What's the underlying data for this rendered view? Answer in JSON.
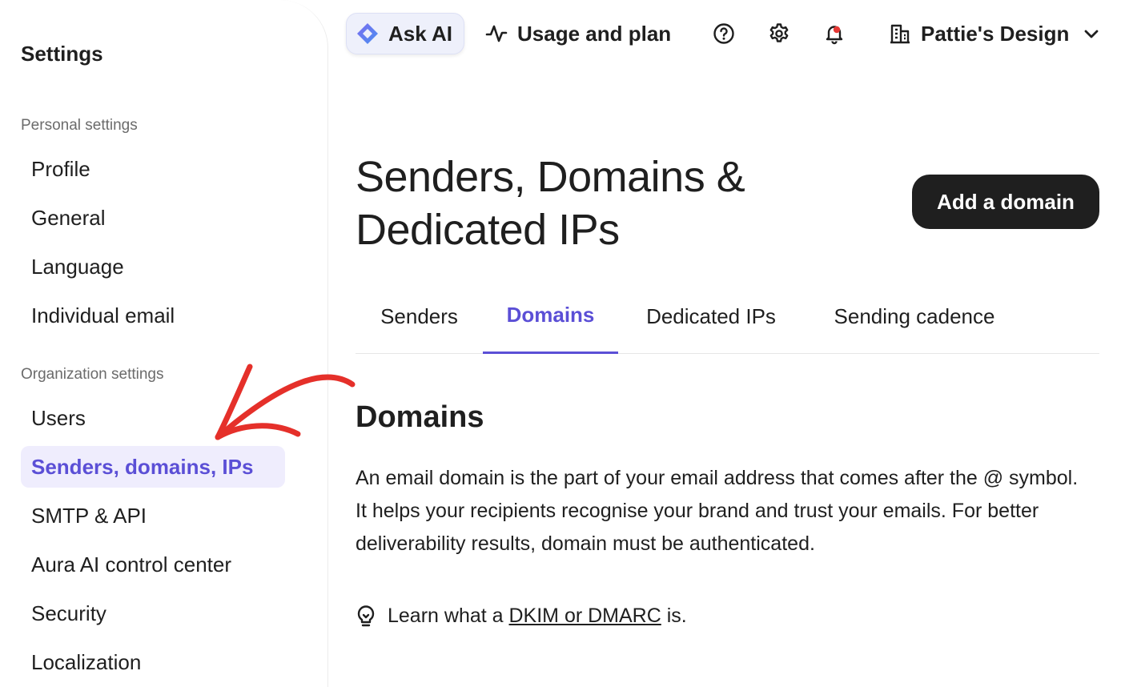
{
  "sidebar": {
    "title": "Settings",
    "personal_label": "Personal settings",
    "personal_items": [
      "Profile",
      "General",
      "Language",
      "Individual email"
    ],
    "organization_label": "Organization settings",
    "organization_items": [
      "Users",
      "Senders, domains, IPs",
      "SMTP & API",
      "Aura AI control center",
      "Security",
      "Localization"
    ],
    "active_item": "Senders, domains, IPs"
  },
  "topbar": {
    "ask_ai": "Ask AI",
    "usage": "Usage and plan",
    "account": "Pattie's Design",
    "icons": [
      "help-icon",
      "gear-icon",
      "bell-icon",
      "building-icon",
      "chevron-down-icon"
    ]
  },
  "main": {
    "title": "Senders, Domains & Dedicated IPs",
    "add_button": "Add a domain",
    "tabs": [
      "Senders",
      "Domains",
      "Dedicated IPs",
      "Sending cadence"
    ],
    "active_tab": "Domains",
    "heading": "Domains",
    "description": "An email domain is the part of your email address that comes after the @ symbol. It helps your recipients recognise your brand and trust your emails. For better deliverability results, domain must be authenticated.",
    "learn_prefix": "Learn what a",
    "learn_link": "DKIM or DMARC",
    "learn_suffix": "is."
  },
  "colors": {
    "accent": "#5b4fd6",
    "active_bg": "#efedfd",
    "annotation_arrow": "#e5302a",
    "button_dark": "#1f1f1f"
  }
}
